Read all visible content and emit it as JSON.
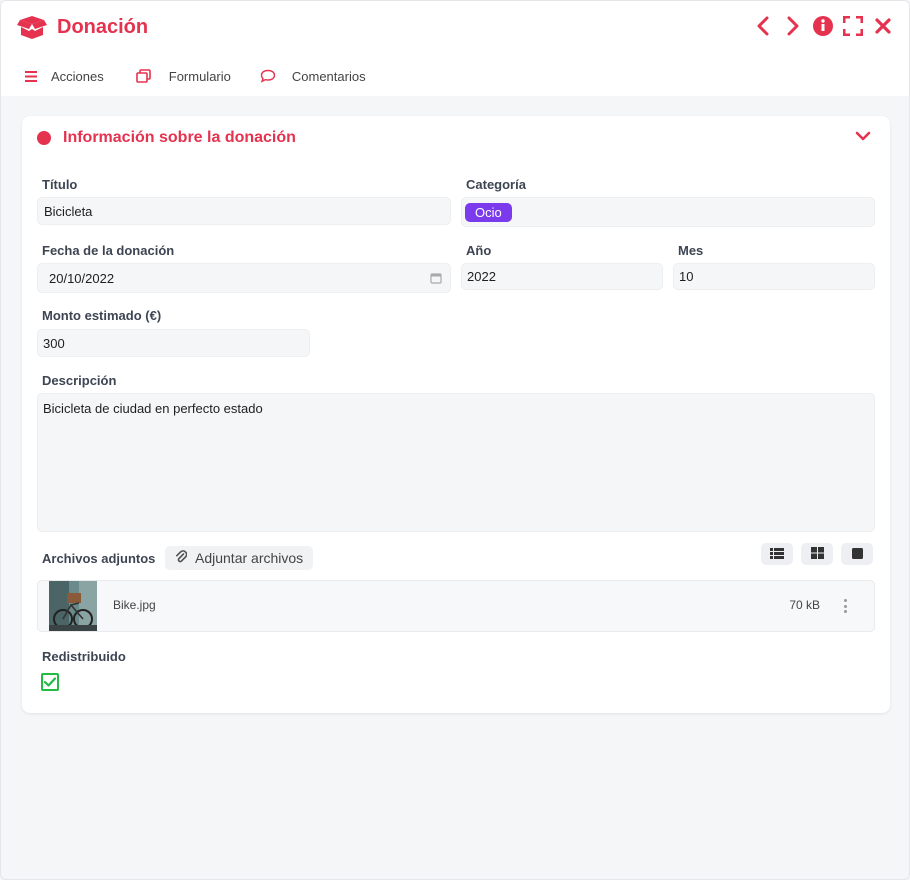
{
  "header": {
    "title": "Donación",
    "menu": [
      {
        "label": "Acciones",
        "icon": "list-icon"
      },
      {
        "label": "Formulario",
        "icon": "forms-icon"
      },
      {
        "label": "Comentarios",
        "icon": "comment-icon"
      }
    ],
    "controls": [
      "chevron-left-icon",
      "chevron-right-icon",
      "info-icon",
      "fullscreen-icon",
      "close-icon"
    ]
  },
  "section": {
    "title": "Información sobre la donación",
    "fields": {
      "titulo": {
        "label": "Título",
        "value": "Bicicleta"
      },
      "categoria": {
        "label": "Categoría",
        "value": "Ocio"
      },
      "fecha": {
        "label": "Fecha de la donación",
        "value": "20/10/2022"
      },
      "anio": {
        "label": "Año",
        "value": "2022"
      },
      "mes": {
        "label": "Mes",
        "value": "10"
      },
      "monto": {
        "label": "Monto estimado (€)",
        "value": "300"
      },
      "descripcion": {
        "label": "Descripción",
        "value": "Bicicleta de ciudad en perfecto estado"
      }
    },
    "attachments": {
      "label": "Archivos adjuntos",
      "add_button": "Adjuntar archivos",
      "files": [
        {
          "name": "Bike.jpg",
          "size": "70 kB"
        }
      ]
    },
    "redistribuido": {
      "label": "Redistribuido",
      "checked": true
    }
  },
  "colors": {
    "accent": "#e5324f",
    "tag": "#7c3aed",
    "check": "#22bb44"
  }
}
